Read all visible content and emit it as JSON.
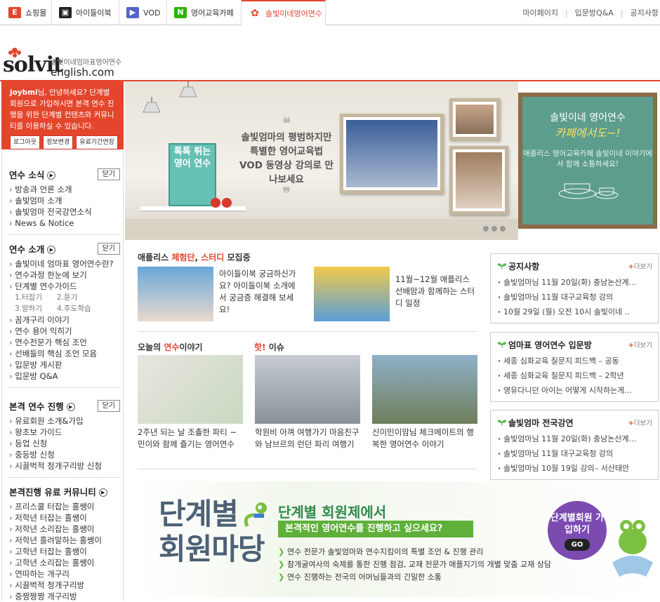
{
  "nav": {
    "tabs": [
      {
        "label": "쇼핑몰",
        "icon": "shop-e-icon",
        "color": "#e3462c"
      },
      {
        "label": "아이들이북",
        "icon": "ebook-icon",
        "color": "#222"
      },
      {
        "label": "VOD",
        "icon": "play-icon",
        "color": "#5563c8"
      },
      {
        "label": "영어교육카페",
        "icon": "naver-n-icon",
        "color": "#2db400"
      },
      {
        "label": "솔빛이네영어연수",
        "icon": "flower-icon",
        "color": "#e3462c"
      }
    ],
    "links": [
      "마이페이지",
      "입문방Q&A",
      "공지사항"
    ]
  },
  "logo": {
    "subtitle": "솔빛이네엄마표영어연수",
    "name": "solvit",
    "domain": "english.com"
  },
  "login": {
    "user": "joybmi",
    "greeting": "님, 안녕하세요?",
    "message": "단계별 회원으로 가입하시면 본격 연수 진행을 위한 단계별 컨텐츠와 커뮤니티를 이용하실 수 있습니다.",
    "buttons": [
      "로그아웃",
      "정보변경",
      "유료기간연장"
    ]
  },
  "sidebar": {
    "close_label": "닫기",
    "sections": [
      {
        "title": "연수 소식",
        "items": [
          "방송과 언론 소개",
          "솔빛엄마 소개",
          "솔빛엄마 전국강연소식",
          "News & Notice"
        ]
      },
      {
        "title": "연수 소개",
        "items": [
          "솔빛이네 엄마표 영어연수란?",
          "연수과정 한눈에 보기",
          "단계별 연수가이드"
        ],
        "subitems": [
          "1.터잡기",
          "2.듣기",
          "3.말하기",
          "4.주도학습"
        ],
        "items2": [
          "꼼개구리 이야기",
          "연수 용어 익히기",
          "연수전문가 핵심 조언",
          "선배들의 핵심 조언 모음",
          "입문방 게시판",
          "입문방 Q&A"
        ]
      },
      {
        "title": "본격 연수 진행",
        "items": [
          "유료회원 소개&가입",
          "왕초보 가이드",
          "등업 신청",
          "중등방 신청",
          "시끌벅적 청개구리방 신청"
        ]
      },
      {
        "title": "본격진행 유료 커뮤니티",
        "items": [
          "프리스쿨 터잡는 홀쌩이",
          "저학년 터잡는 홀쌩이",
          "저학년 소리잡는 홀쌩이",
          "저학년 흘려말하는 홀쌩이",
          "고학년 터잡는 홀쌩이",
          "고학년 소리잡는 홀쌩이",
          "연따하는 개구리",
          "시끌벅적 청개구리방",
          "중짱짱짱 개구리방"
        ]
      }
    ]
  },
  "banner": {
    "quote": "솔빛엄마의 평범하지만 특별한 영어교육법 VOD 동영상 강의로 만나보세요",
    "book": "톡톡 튀는 영어 연수",
    "cafe_title": "솔빛이네 영어연수",
    "cafe_title2": "카페에서도~!",
    "cafe_desc": "애플리스 영어교육카페 솔빛이네 이야기에서 함께 소통하세요!"
  },
  "recruit": {
    "title_pre": "애플리스 ",
    "title_hl1": "체험단",
    "title_mid": ", ",
    "title_hl2": "스터디",
    "title_post": " 모집중",
    "items": [
      "아이들이북 궁금하신가요? 아이들이북 소개에서 궁금증 해결해 보세요!",
      "11월~12월 애플리스 선배맘과 함께하는 스터디 일정"
    ]
  },
  "today": {
    "title_pre": "오늘의 ",
    "title_hl": "연수",
    "title_post": "이야기",
    "hot_hl": "핫!",
    "hot_post": " 이슈",
    "items": [
      "2주년 되는 날 조촐한 파티 ~ 민이와 함께 즐기는 영어연수",
      "학원비 아껴 여행가기 마음친구와 남브르의 런던 파리 여행기",
      "신이민이맘님 체크메이트의 행복한 영어연수 이야기"
    ]
  },
  "notices": [
    {
      "title": "공지사항",
      "more": "더보기",
      "items": [
        "솔빛엄마님 11월 20일(화) 충남논산계...",
        "솔빛엄마님 11월 대구교육청 강의",
        "10월 29일 (월) 오전 10시 솔빛이네 .."
      ]
    },
    {
      "title": "엄마표 영어연수 입문방",
      "more": "더보기",
      "items": [
        "세종 심화교육 질문지 피드백 – 공동",
        "세종 심화교육 질문지 피드백 – 2학년",
        "영유다니던 아이는 어떻게 시작하는게..."
      ]
    },
    {
      "title": "솔빛엄마 전국강연",
      "more": "더보기",
      "items": [
        "솔빛엄마님 11월 20일(화) 충남논산계...",
        "솔빛엄마님 11월 대구교육청 강의",
        "솔빛엄마님 10월 19일 강의– 서산태안"
      ]
    }
  ],
  "bottom": {
    "big1": "단계별",
    "big2": "회원마당",
    "heading": "단계별 회원제에서",
    "bar": "본격적인 영어연수를 진행하고 싶으세요?",
    "bullets": [
      "연수 전문가 솔빛엄마와 연수지킴이의 특별 조언 & 진행 관리",
      "참개굴여사의 숙제를 통한 진행 점검, 교재 전문가 애플지기의 개별 맞춤 교재 상담",
      "연수 진행하는 전국의 어머님들과의 긴밀한 소통"
    ],
    "cta": "단계별회원 가입하기",
    "go": "GO"
  }
}
